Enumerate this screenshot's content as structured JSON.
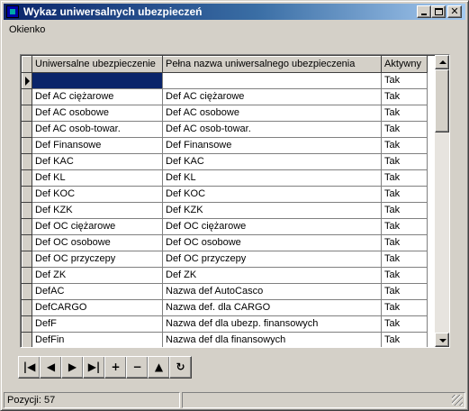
{
  "window": {
    "title": "Wykaz uniwersalnych ubezpieczeń"
  },
  "title_buttons": {
    "minimize": "_",
    "maximize": "□",
    "close": "✕"
  },
  "menu": {
    "items": [
      "Okienko"
    ]
  },
  "grid": {
    "columns": [
      "Uniwersalne ubezpieczenie",
      "Pełna nazwa uniwersalnego ubezpieczenia",
      "Aktywny"
    ],
    "rows": [
      [
        "",
        "",
        "Tak"
      ],
      [
        "Def AC ciężarowe",
        "Def AC ciężarowe",
        "Tak"
      ],
      [
        "Def AC osobowe",
        "Def AC osobowe",
        "Tak"
      ],
      [
        "Def AC osob-towar.",
        "Def AC osob-towar.",
        "Tak"
      ],
      [
        "Def Finansowe",
        "Def Finansowe",
        "Tak"
      ],
      [
        "Def KAC",
        "Def KAC",
        "Tak"
      ],
      [
        "Def KL",
        "Def KL",
        "Tak"
      ],
      [
        "Def KOC",
        "Def KOC",
        "Tak"
      ],
      [
        "Def KZK",
        "Def KZK",
        "Tak"
      ],
      [
        "Def OC ciężarowe",
        "Def OC ciężarowe",
        "Tak"
      ],
      [
        "Def OC osobowe",
        "Def OC osobowe",
        "Tak"
      ],
      [
        "Def OC przyczepy",
        "Def OC przyczepy",
        "Tak"
      ],
      [
        "Def ZK",
        "Def ZK",
        "Tak"
      ],
      [
        "DefAC",
        "Nazwa def AutoCasco",
        "Tak"
      ],
      [
        "DefCARGO",
        "Nazwa def. dla CARGO",
        "Tak"
      ],
      [
        "DefF",
        "Nazwa def dla ubezp. finansowych",
        "Tak"
      ],
      [
        "DefFin",
        "Nazwa def dla finansowych",
        "Tak"
      ],
      [
        "",
        "",
        ""
      ]
    ]
  },
  "navigator": {
    "buttons": [
      {
        "name": "first-record-button",
        "glyph": "|◀"
      },
      {
        "name": "prior-record-button",
        "glyph": "◀"
      },
      {
        "name": "next-record-button",
        "glyph": "▶"
      },
      {
        "name": "last-record-button",
        "glyph": "▶|"
      },
      {
        "name": "insert-record-button",
        "glyph": "+"
      },
      {
        "name": "delete-record-button",
        "glyph": "−"
      },
      {
        "name": "edit-record-button",
        "glyph": "▲"
      },
      {
        "name": "refresh-button",
        "glyph": "↻"
      }
    ]
  },
  "status": {
    "text": "Pozycji: 57",
    "panel2": ""
  }
}
